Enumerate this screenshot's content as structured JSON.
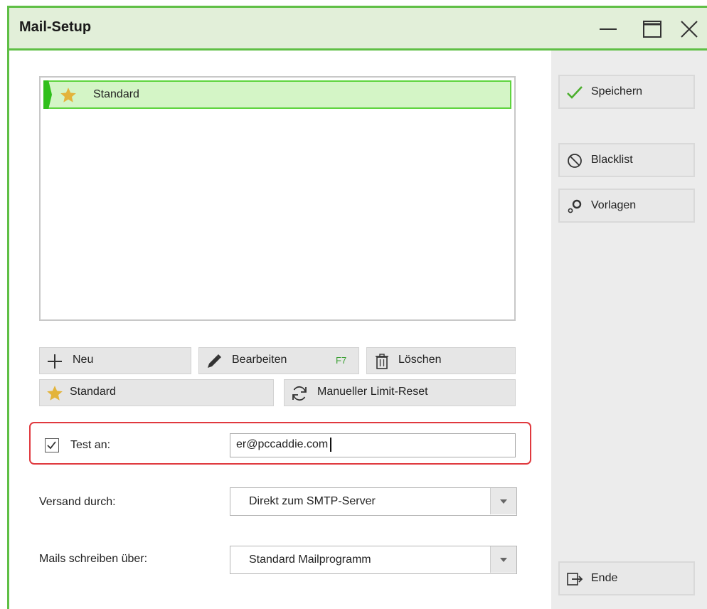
{
  "window": {
    "title": "Mail-Setup",
    "controls": [
      "minimize",
      "maximize",
      "close"
    ]
  },
  "profile_list": {
    "items": [
      {
        "label": "Standard",
        "icon": "star-icon",
        "selected": true
      }
    ]
  },
  "actions": {
    "new_label": "Neu",
    "edit_label": "Bearbeiten",
    "edit_shortcut": "F7",
    "delete_label": "Löschen",
    "standard_label": "Standard",
    "limit_reset_label": "Manueller Limit-Reset"
  },
  "test": {
    "checked": true,
    "label": "Test an:",
    "value": "er@pccaddie.com"
  },
  "versand": {
    "label": "Versand durch:",
    "value": "Direkt zum SMTP-Server"
  },
  "mails": {
    "label": "Mails schreiben über:",
    "value": "Standard Mailprogramm"
  },
  "sidebar": {
    "save_label": "Speichern",
    "blacklist_label": "Blacklist",
    "templates_label": "Vorlagen",
    "end_label": "Ende"
  },
  "colors": {
    "accent_green": "#5fbf45",
    "selection_bg": "#d4f5c6",
    "highlight_red": "#e0393e",
    "star_gold": "#e3b43b"
  }
}
